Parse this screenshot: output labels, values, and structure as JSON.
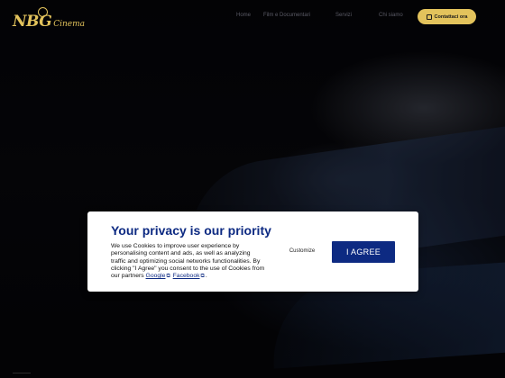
{
  "brand": {
    "mark": "NBG",
    "text": "Cinema",
    "accent_color": "#e3c35c"
  },
  "nav": {
    "items": [
      "Home",
      "Film e Documentari",
      "Servizi",
      "Chi siamo"
    ],
    "cta_label": "Contattaci ora",
    "cta_icon": "mail-icon"
  },
  "privacy": {
    "title": "Your privacy is our priority",
    "body_prefix": "We use Cookies to improve user experience by personalising content and ads, as well as analyzing traffic and optimizing social networks functionalities. By clicking \"I Agree\" you consent to the use of Cookies from our partners ",
    "link_google": "Google",
    "link_facebook": "Facebook",
    "body_suffix": ".",
    "external_icon": "external-link-icon",
    "customize_label": "Customize",
    "agree_label": "I AGREE",
    "primary_color": "#0d2a82"
  }
}
